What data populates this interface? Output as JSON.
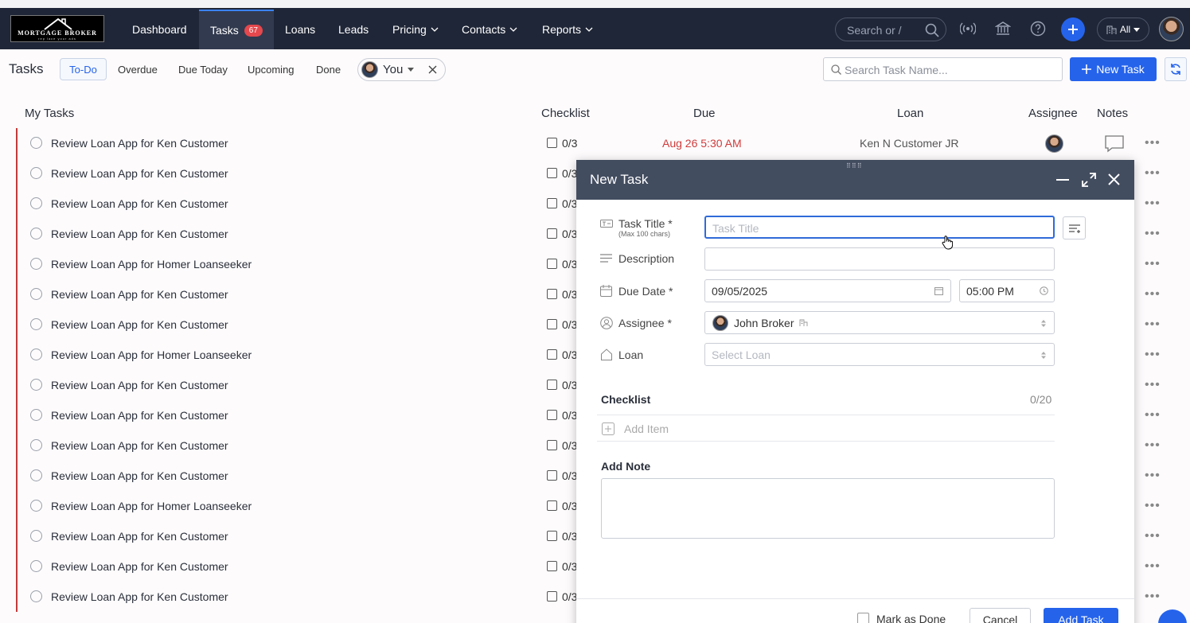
{
  "brand": {
    "logo_text": "MORTGAGE BROKER",
    "logo_tagline": "rep lace  your  ads"
  },
  "nav": {
    "items": [
      {
        "label": "Dashboard",
        "active": false,
        "dropdown": false
      },
      {
        "label": "Tasks",
        "active": true,
        "badge": "67",
        "dropdown": false
      },
      {
        "label": "Loans",
        "active": false,
        "dropdown": false
      },
      {
        "label": "Leads",
        "active": false,
        "dropdown": false
      },
      {
        "label": "Pricing",
        "active": false,
        "dropdown": true
      },
      {
        "label": "Contacts",
        "active": false,
        "dropdown": true
      },
      {
        "label": "Reports",
        "active": false,
        "dropdown": true
      }
    ],
    "search_placeholder": "Search or /",
    "all_label": "All",
    "icons": [
      "broadcast-icon",
      "bank-icon",
      "help-icon",
      "plus-icon"
    ]
  },
  "toolbar": {
    "title": "Tasks",
    "filters": [
      "To-Do",
      "Overdue",
      "Due Today",
      "Upcoming",
      "Done"
    ],
    "active_filter": "To-Do",
    "assignee_chip": "You",
    "search_placeholder": "Search Task Name...",
    "new_task_label": "New Task"
  },
  "table": {
    "headers": {
      "name": "My Tasks",
      "checklist": "Checklist",
      "due": "Due",
      "loan": "Loan",
      "assignee": "Assignee",
      "notes": "Notes"
    },
    "rows": [
      {
        "title": "Review Loan App for Ken Customer",
        "checklist": "0/3",
        "due": "Aug 26 5:30 AM",
        "loan": "Ken N Customer JR"
      },
      {
        "title": "Review Loan App for Ken Customer",
        "checklist": "0/3"
      },
      {
        "title": "Review Loan App for Ken Customer",
        "checklist": "0/3"
      },
      {
        "title": "Review Loan App for Ken Customer",
        "checklist": "0/3"
      },
      {
        "title": "Review Loan App for Homer Loanseeker",
        "checklist": "0/3"
      },
      {
        "title": "Review Loan App for Ken Customer",
        "checklist": "0/3"
      },
      {
        "title": "Review Loan App for Ken Customer",
        "checklist": "0/3"
      },
      {
        "title": "Review Loan App for Homer Loanseeker",
        "checklist": "0/3"
      },
      {
        "title": "Review Loan App for Ken Customer",
        "checklist": "0/3"
      },
      {
        "title": "Review Loan App for Ken Customer",
        "checklist": "0/3"
      },
      {
        "title": "Review Loan App for Ken Customer",
        "checklist": "0/3"
      },
      {
        "title": "Review Loan App for Ken Customer",
        "checklist": "0/3"
      },
      {
        "title": "Review Loan App for Homer Loanseeker",
        "checklist": "0/3"
      },
      {
        "title": "Review Loan App for Ken Customer",
        "checklist": "0/3"
      },
      {
        "title": "Review Loan App for Ken Customer",
        "checklist": "0/3"
      },
      {
        "title": "Review Loan App for Ken Customer",
        "checklist": "0/3"
      }
    ]
  },
  "modal": {
    "title": "New Task",
    "fields": {
      "task_title": {
        "label": "Task Title *",
        "hint": "(Max 100 chars)",
        "placeholder": "Task Title",
        "value": ""
      },
      "description": {
        "label": "Description",
        "value": ""
      },
      "due_date": {
        "label": "Due Date *",
        "date": "09/05/2025",
        "time": "05:00 PM"
      },
      "assignee": {
        "label": "Assignee *",
        "value": "John Broker"
      },
      "loan": {
        "label": "Loan",
        "placeholder": "Select Loan"
      }
    },
    "checklist": {
      "title": "Checklist",
      "count": "0/20",
      "add_item": "Add Item"
    },
    "note": {
      "title": "Add Note",
      "value": ""
    },
    "footer": {
      "mark_done": "Mark as Done",
      "cancel": "Cancel",
      "add": "Add Task"
    }
  },
  "colors": {
    "nav_bg": "#1f2637",
    "accent": "#2563eb",
    "overdue": "#d03b3b",
    "modal_header": "#434d60"
  }
}
